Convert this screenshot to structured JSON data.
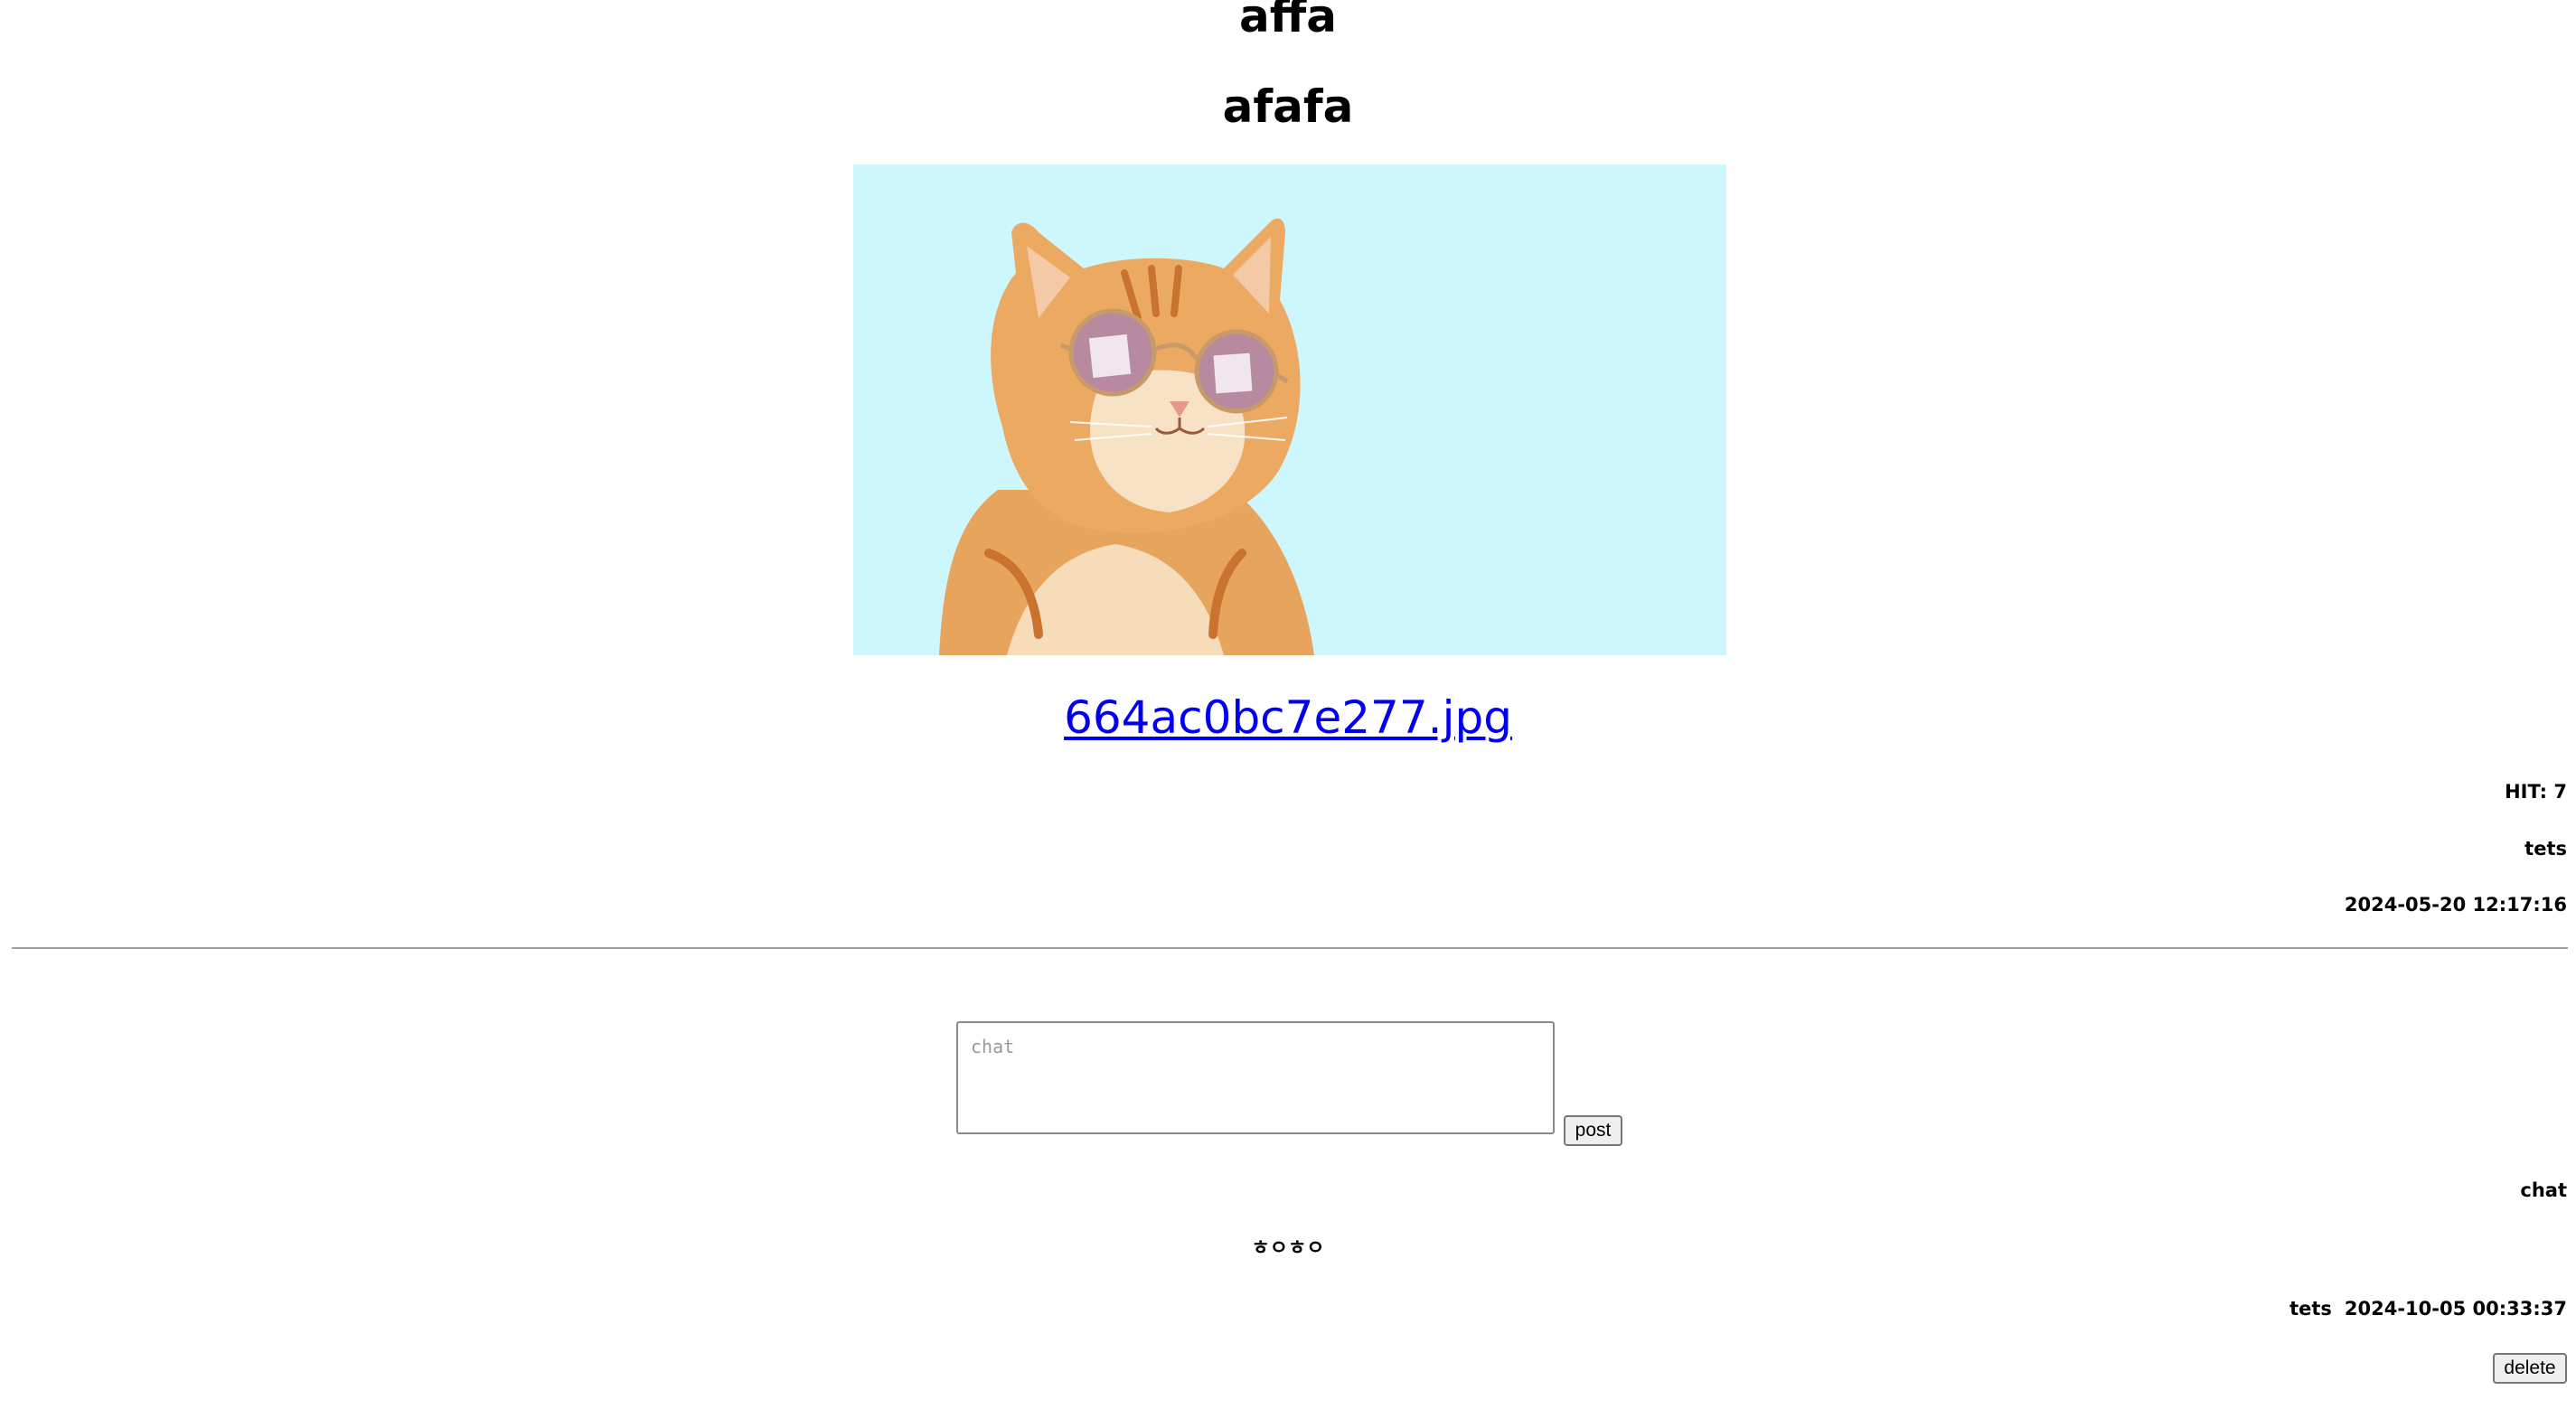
{
  "post": {
    "title": "affa",
    "subtitle": "afafa",
    "file_name": "664ac0bc7e277.jpg",
    "hit": "HIT: 7",
    "author": "tets",
    "created_at": "2024-05-20 12:17:16"
  },
  "comment_form": {
    "placeholder": "chat",
    "value": "",
    "post_label": "post"
  },
  "comments": {
    "header": "chat",
    "items": [
      {
        "text": "ㅎㅇㅎㅇ",
        "author": "tets",
        "created_at": "2024-10-05 00:33:37",
        "delete_label": "delete"
      }
    ]
  },
  "colors": {
    "link": "#0000ee",
    "image_background": "#cef7fd"
  }
}
